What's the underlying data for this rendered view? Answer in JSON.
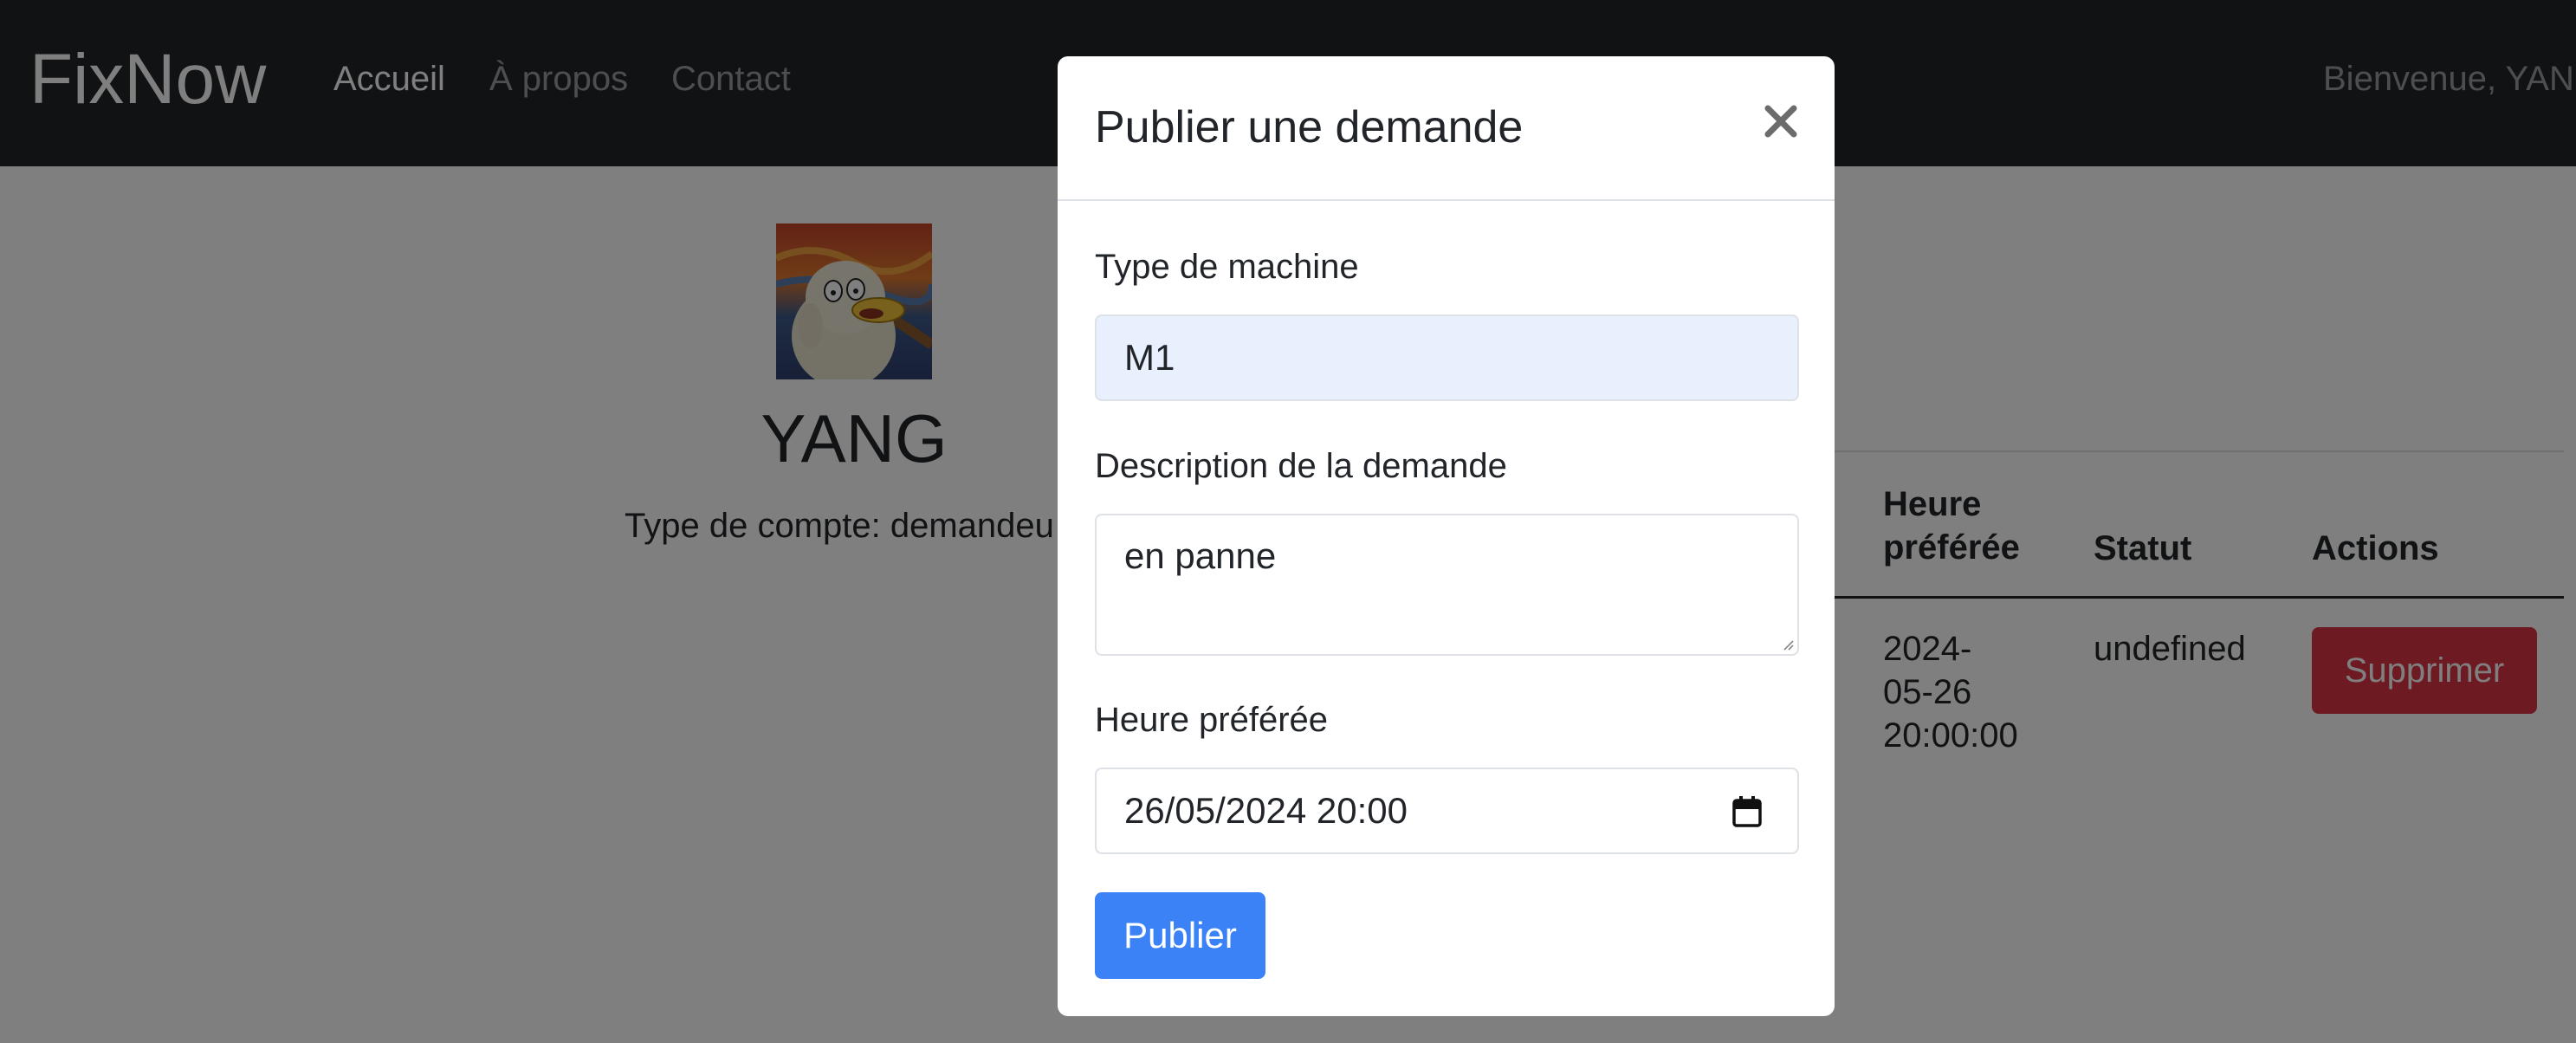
{
  "navbar": {
    "brand": "FixNow",
    "links": [
      {
        "label": "Accueil",
        "active": true
      },
      {
        "label": "À propos",
        "active": false
      },
      {
        "label": "Contact",
        "active": false
      }
    ],
    "welcome": "Bienvenue, YAN"
  },
  "profile": {
    "avatar_icon": "user-avatar-image",
    "name": "YANG",
    "account_type": "Type de compte: demandeu"
  },
  "table": {
    "headers": {
      "heure_line1": "Heure",
      "heure_line2": "préférée",
      "statut": "Statut",
      "actions": "Actions"
    },
    "rows": [
      {
        "heure_line1": "2024-",
        "heure_line2": "05-26",
        "heure_line3": "20:00:00",
        "statut": "undefined",
        "action_label": "Supprimer"
      }
    ]
  },
  "modal": {
    "title": "Publier une demande",
    "close_icon": "close-icon",
    "fields": {
      "machine": {
        "label": "Type de machine",
        "value": "M1"
      },
      "description": {
        "label": "Description de la demande",
        "value": "en panne"
      },
      "heure": {
        "label": "Heure préférée",
        "value": "26/05/2024 20:00",
        "icon": "calendar-icon"
      }
    },
    "submit_label": "Publier"
  },
  "colors": {
    "navbar_bg": "#212529",
    "primary": "#3b82f6",
    "danger": "#dc3545",
    "autofill_bg": "#e8f0fe",
    "backdrop": "rgba(0,0,0,0.5)"
  }
}
